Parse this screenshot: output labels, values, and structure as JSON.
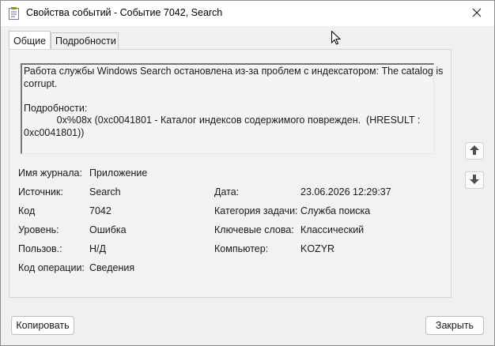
{
  "window": {
    "title": "Свойства событий - Событие 7042, Search"
  },
  "tabs": [
    {
      "label": "Общие",
      "active": true
    },
    {
      "label": "Подробности",
      "active": false
    }
  ],
  "description": {
    "line1": "Работа службы Windows Search остановлена из-за проблем с индексатором: The catalog is",
    "line2": "corrupt.",
    "line3": "",
    "line4": "Подробности:",
    "line5": "            0x%08x (0xc0041801 - Каталог индексов содержимого поврежден.  (HRESULT :",
    "line6": "0xc0041801))"
  },
  "fields": {
    "log_name_label": "Имя журнала:",
    "log_name_value": "Приложение",
    "source_label": "Источник:",
    "source_value": "Search",
    "date_label": "Дата:",
    "date_value": "23.06.2026 12:29:37",
    "code_label": "Код",
    "code_value": "7042",
    "task_category_label": "Категория задачи:",
    "task_category_value": "Служба поиска",
    "level_label": "Уровень:",
    "level_value": "Ошибка",
    "keywords_label": "Ключевые слова:",
    "keywords_value": "Классический",
    "user_label": "Пользов.:",
    "user_value": "Н/Д",
    "computer_label": "Компьютер:",
    "computer_value": "KOZYR",
    "opcode_label": "Код операции:",
    "opcode_value": "Сведения"
  },
  "buttons": {
    "copy": "Копировать",
    "close": "Закрыть"
  },
  "icons": {
    "title": "event-properties-icon",
    "close": "close-icon",
    "up": "arrow-up-icon",
    "down": "arrow-down-icon"
  }
}
